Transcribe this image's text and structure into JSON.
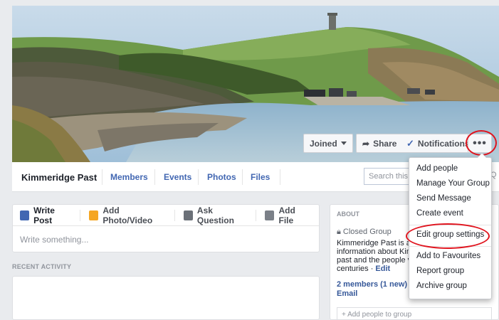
{
  "cover": {
    "buttons": {
      "joined": "Joined",
      "share": "Share",
      "notifications": "Notifications",
      "more": "•••"
    }
  },
  "nav": {
    "group_name": "Kimmeridge Past",
    "tabs": [
      "Members",
      "Events",
      "Photos",
      "Files"
    ],
    "search_placeholder": "Search this group"
  },
  "composer": {
    "tabs": [
      "Write Post",
      "Add Photo/Video",
      "Ask Question",
      "Add File"
    ],
    "placeholder": "Write something..."
  },
  "recent_activity_label": "RECENT ACTIVITY",
  "about": {
    "heading": "ABOUT",
    "privacy": "Closed Group",
    "description_lines": [
      "Kimmeridge Past is a",
      "information about Kim",
      "past and the people v",
      "centuries ·"
    ],
    "edit_link": "Edit",
    "members_text": "2 members (1 new)",
    "email_text": "Email",
    "add_people_placeholder": "+ Add people to group"
  },
  "dropdown": {
    "items": [
      "Add people",
      "Manage Your Group",
      "Send Message",
      "Create event",
      "Edit group settings",
      "Add to Favourites",
      "Report group",
      "Archive group"
    ]
  },
  "colors": {
    "accent": "#4267b2",
    "highlight_ring": "#e0141e",
    "page_bg": "#e9ebee"
  }
}
